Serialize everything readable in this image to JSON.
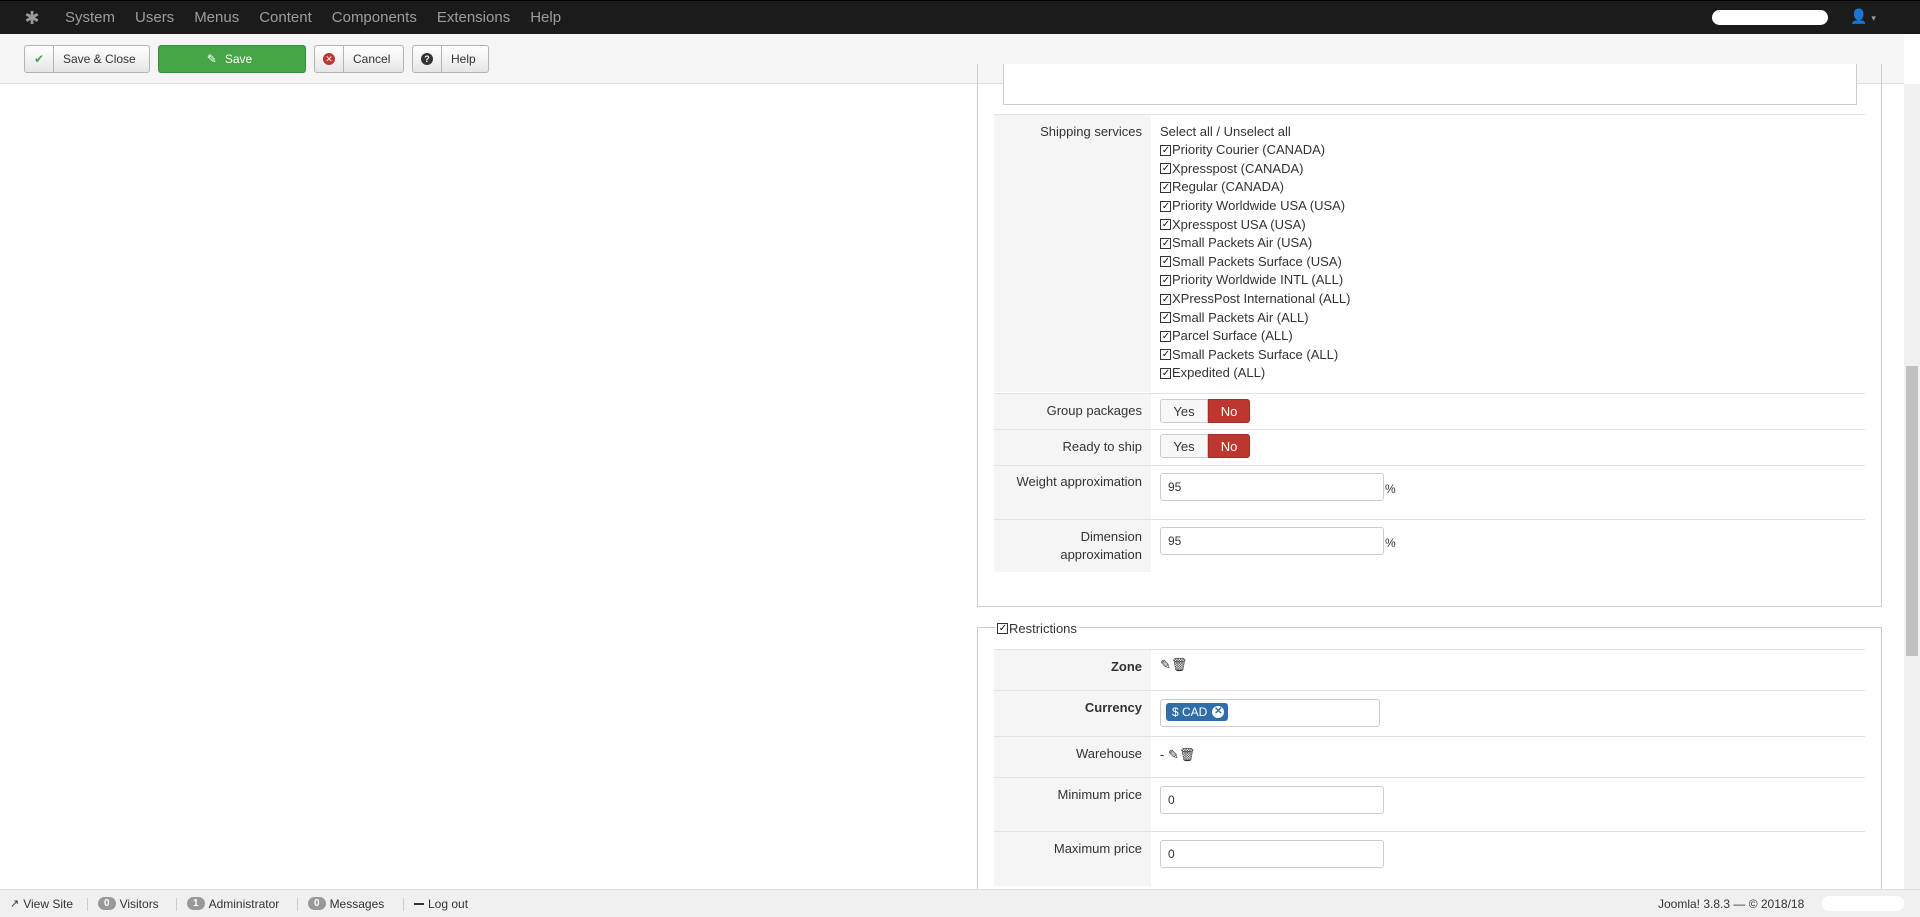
{
  "navbar": {
    "logo_icon": "joomla-logo-icon",
    "menu": [
      "System",
      "Users",
      "Menus",
      "Content",
      "Components",
      "Extensions",
      "Help"
    ],
    "user_icon": "user-icon"
  },
  "toolbar": {
    "save_close": "Save & Close",
    "save": "Save",
    "cancel": "Cancel",
    "help": "Help"
  },
  "shipping": {
    "label": "Shipping services",
    "select_all": "Select all / Unselect all",
    "services": [
      "Priority Courier (CANADA)",
      "Xpresspost (CANADA)",
      "Regular (CANADA)",
      "Priority Worldwide USA (USA)",
      "Xpresspost USA (USA)",
      "Small Packets Air (USA)",
      "Small Packets Surface (USA)",
      "Priority Worldwide INTL (ALL)",
      "XPressPost International (ALL)",
      "Small Packets Air (ALL)",
      "Parcel Surface (ALL)",
      "Small Packets Surface (ALL)",
      "Expedited (ALL)"
    ]
  },
  "group_packages": {
    "label": "Group packages",
    "yes": "Yes",
    "no": "No",
    "selected": "No"
  },
  "ready_to_ship": {
    "label": "Ready to ship",
    "yes": "Yes",
    "no": "No",
    "selected": "No"
  },
  "weight": {
    "label": "Weight approximation",
    "value": "95",
    "unit": "%"
  },
  "dimension": {
    "label_line1": "Dimension",
    "label_line2": "approximation",
    "value": "95",
    "unit": "%"
  },
  "restrictions": {
    "legend": "Restrictions",
    "zone_label": "Zone",
    "currency_label": "Currency",
    "currency_tag": "$ CAD",
    "warehouse_label": "Warehouse",
    "warehouse_value": "-",
    "min_price_label": "Minimum price",
    "min_price": "0",
    "max_price_label": "Maximum price",
    "max_price": "0"
  },
  "footer": {
    "view_site": "View Site",
    "visitors_count": "0",
    "visitors": "Visitors",
    "admin_count": "1",
    "admin": "Administrator",
    "messages_count": "0",
    "messages": "Messages",
    "logout": "Log out",
    "version": "Joomla! 3.8.3 — © 2018/18"
  }
}
